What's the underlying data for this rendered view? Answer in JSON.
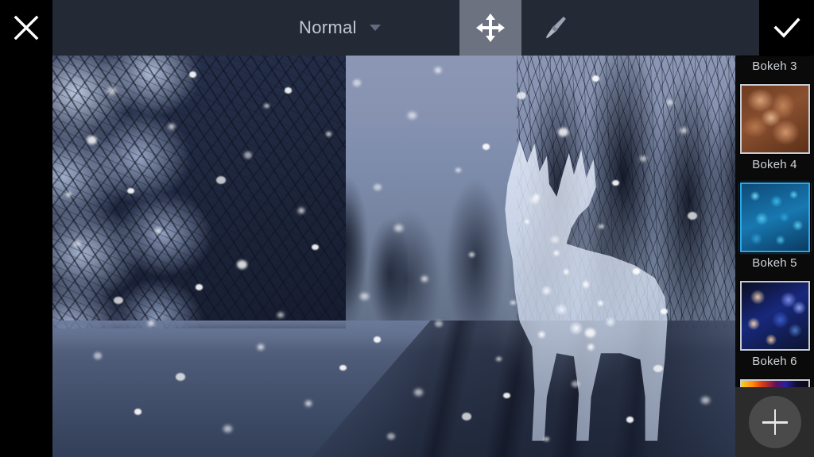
{
  "app": {
    "name": "photo-editor-overlay",
    "accent_color": "#2aa8e8",
    "toolbar_bg": "#262c3a",
    "panel_bg": "#0a0a0a"
  },
  "toolbar": {
    "close_icon": "close-x-icon",
    "close_label": "Close",
    "blend_mode_label": "Normal",
    "blend_mode_chevron": "chevron-down-icon",
    "move_tool_icon": "move-arrows-icon",
    "move_tool_label": "Move",
    "move_tool_active": true,
    "brush_tool_icon": "paintbrush-icon",
    "brush_tool_label": "Brush",
    "confirm_icon": "checkmark-icon",
    "confirm_label": "Apply"
  },
  "canvas": {
    "name": "image-canvas",
    "description": "Winter forest road at dusk with falling snow and a glowing bokeh deer overlay"
  },
  "sidebar": {
    "name": "bokeh-overlay-list",
    "items": [
      {
        "label": "Bokeh 3",
        "selected": false,
        "partial": true,
        "texture": "tx-b3"
      },
      {
        "label": "Bokeh 4",
        "selected": false,
        "partial": false,
        "texture": "tx-b4"
      },
      {
        "label": "Bokeh 5",
        "selected": true,
        "partial": false,
        "texture": "tx-b5"
      },
      {
        "label": "Bokeh 6",
        "selected": false,
        "partial": false,
        "texture": "tx-b6"
      },
      {
        "label": "",
        "selected": false,
        "partial": true,
        "texture": "tx-b7"
      }
    ],
    "add_button_icon": "plus-icon",
    "add_button_label": "Add"
  }
}
